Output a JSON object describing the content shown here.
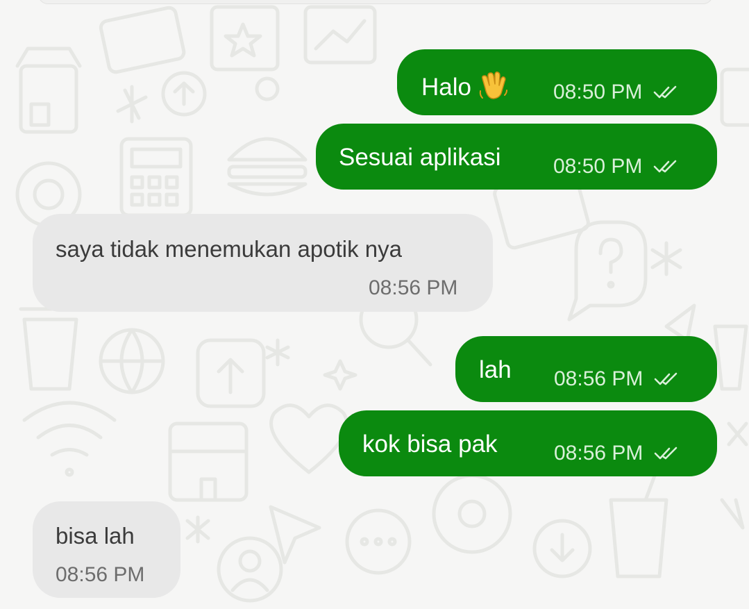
{
  "messages": [
    {
      "text": "Halo",
      "time": "08:50 PM",
      "emoji": "waving-hand"
    },
    {
      "text": "Sesuai aplikasi",
      "time": "08:50 PM"
    },
    {
      "text": "saya tidak menemukan apotik nya",
      "time": "08:56 PM"
    },
    {
      "text": "lah",
      "time": "08:56 PM"
    },
    {
      "text": "kok bisa pak",
      "time": "08:56 PM"
    },
    {
      "text": "bisa lah",
      "time": "08:56 PM"
    }
  ],
  "colors": {
    "outgoing_bubble": "#0b8a0f",
    "incoming_bubble": "#e8e8e8",
    "background": "#f6f6f5"
  },
  "icons": {
    "read_receipt": "double-check-icon",
    "wallpaper": "doodle-pattern"
  }
}
